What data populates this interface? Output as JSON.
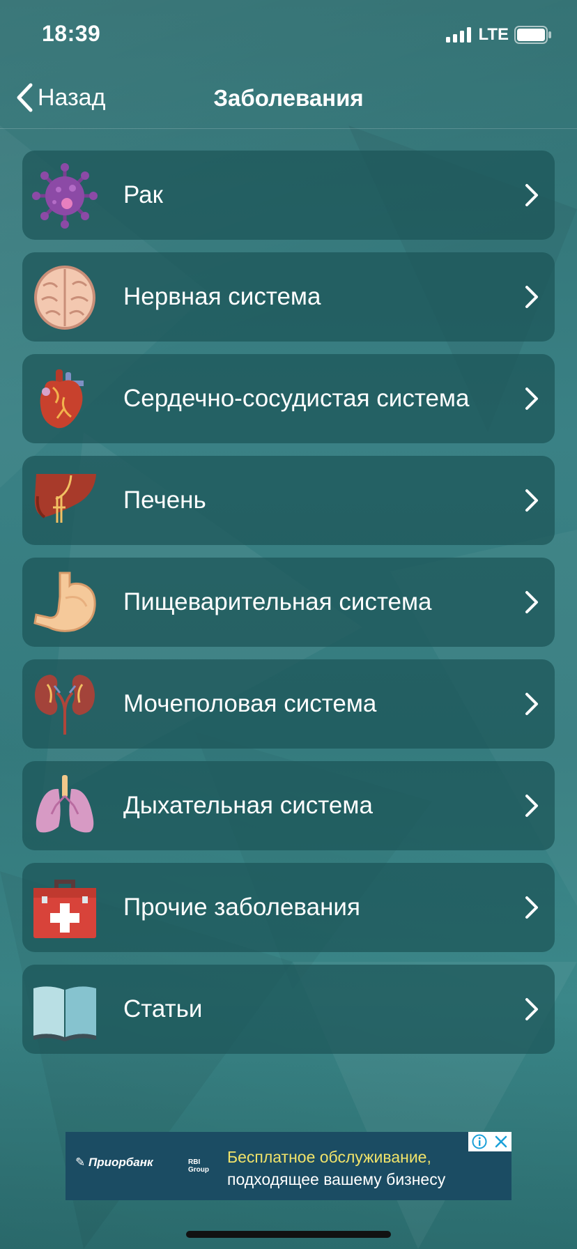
{
  "status_bar": {
    "time": "18:39",
    "network": "LTE"
  },
  "nav": {
    "back_label": "Назад",
    "title": "Заболевания"
  },
  "menu": [
    {
      "label": "Рак",
      "icon": "virus-icon"
    },
    {
      "label": "Нервная система",
      "icon": "brain-icon"
    },
    {
      "label": "Сердечно-сосудистая система",
      "icon": "heart-icon"
    },
    {
      "label": "Печень",
      "icon": "liver-icon"
    },
    {
      "label": "Пищеварительная система",
      "icon": "stomach-icon"
    },
    {
      "label": "Мочеполовая система",
      "icon": "kidneys-icon"
    },
    {
      "label": "Дыхательная система",
      "icon": "lungs-icon"
    },
    {
      "label": "Прочие заболевания",
      "icon": "first-aid-kit-icon"
    },
    {
      "label": "Статьи",
      "icon": "book-icon"
    }
  ],
  "ad": {
    "brand": "Приорбанк",
    "group_line1": "RBI",
    "group_line2": "Group",
    "line1": "Бесплатное обслуживание,",
    "line2": "подходящее вашему бизнесу"
  },
  "colors": {
    "accent_yellow": "#f1e36a",
    "card_bg": "#1c5458",
    "ad_bg": "#1b4c63"
  }
}
